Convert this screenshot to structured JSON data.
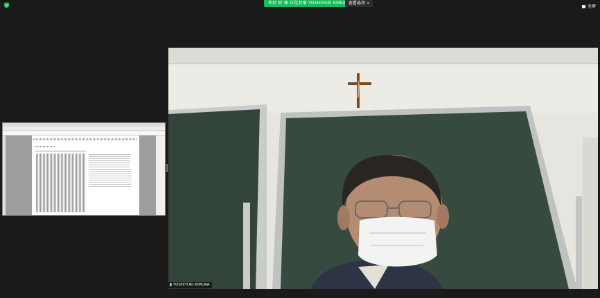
{
  "topbar": {
    "sharing_label": "木村 好 珠 正在共享 YOSHIYUKI KIMURA的屏幕",
    "view_options_label": "查看选项",
    "right_label": "全屏"
  },
  "participant": {
    "name": "YOSHIYUKI KIMURA"
  }
}
